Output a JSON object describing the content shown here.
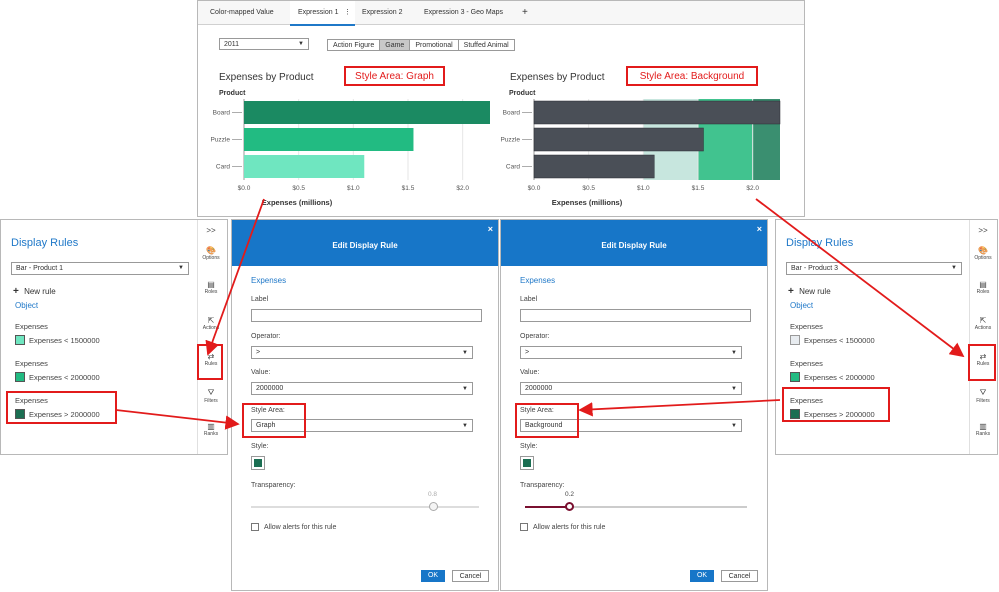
{
  "report": {
    "tabs": [
      "Color-mapped Value",
      "Expression 1",
      "Expression 2",
      "Expression 3 - Geo Maps"
    ],
    "add_tab": "+",
    "year_select": "2011",
    "category_buttons": [
      "Action Figure",
      "Game",
      "Promotional",
      "Stuffed Animal"
    ],
    "selected_category": "Game"
  },
  "annotations": {
    "graph": "Style Area:  Graph",
    "background": "Style Area:  Background"
  },
  "chart_data": [
    {
      "type": "bar",
      "title": "Expenses by Product",
      "ylabel": "Product",
      "xlabel": "Expenses (millions)",
      "categories": [
        "Board",
        "Puzzle",
        "Card"
      ],
      "values": [
        2.25,
        1.55,
        1.1
      ],
      "bar_colors": [
        "#1b8a62",
        "#22bb82",
        "#6fe6c0"
      ],
      "xticks": [
        "$0.0",
        "$0.5",
        "$1.0",
        "$1.5",
        "$2.0"
      ],
      "xlim": [
        0,
        2.25
      ]
    },
    {
      "type": "bar",
      "title": "Expenses by Product",
      "ylabel": "Product",
      "xlabel": "Expenses (millions)",
      "categories": [
        "Board",
        "Puzzle",
        "Card"
      ],
      "values": [
        2.25,
        1.55,
        1.1
      ],
      "bar_color": "#4a4f57",
      "bands": [
        {
          "from": 1.0,
          "to": 1.5,
          "color": "#c7e6de"
        },
        {
          "from": 1.5,
          "to": 2.0,
          "color": "#41c38f"
        },
        {
          "from": 2.0,
          "to": 2.25,
          "color": "#3a8f70"
        }
      ],
      "xticks": [
        "$0.0",
        "$0.5",
        "$1.0",
        "$1.5",
        "$2.0"
      ],
      "xlim": [
        0,
        2.25
      ]
    }
  ],
  "left_panel": {
    "title": "Display Rules",
    "object_select": "Bar - Product 1",
    "new_rule": "New rule",
    "object_link": "Object",
    "rules": [
      {
        "header": "Expenses",
        "label": "Expenses < 1500000",
        "color": "#6fe6c0"
      },
      {
        "header": "Expenses",
        "label": "Expenses < 2000000",
        "color": "#22bb82"
      },
      {
        "header": "Expenses",
        "label": "Expenses > 2000000",
        "color": "#1b6e52"
      }
    ]
  },
  "right_panel": {
    "title": "Display Rules",
    "object_select": "Bar - Product 3",
    "new_rule": "New rule",
    "object_link": "Object",
    "rules": [
      {
        "header": "Expenses",
        "label": "Expenses < 1500000",
        "color": "#e8ecf0"
      },
      {
        "header": "Expenses",
        "label": "Expenses < 2000000",
        "color": "#22bb82"
      },
      {
        "header": "Expenses",
        "label": "Expenses > 2000000",
        "color": "#1b6e52"
      }
    ]
  },
  "rail": {
    "collapse": ">>",
    "items": [
      "Options",
      "Roles",
      "Actions",
      "Rules",
      "Filters",
      "Ranks"
    ]
  },
  "dialog_left": {
    "title": "Edit Display Rule",
    "close": "×",
    "section": "Expenses",
    "label_caption": "Label",
    "operator_caption": "Operator:",
    "operator": ">",
    "value_caption": "Value:",
    "value": "2000000",
    "style_area_caption": "Style Area:",
    "style_area": "Graph",
    "style_caption": "Style:",
    "style_color": "#1b6e52",
    "transparency_caption": "Transparency:",
    "transparency": 0.8,
    "transparency_label": "0.8",
    "alerts": "Allow alerts for this rule",
    "ok": "OK",
    "cancel": "Cancel"
  },
  "dialog_right": {
    "title": "Edit Display Rule",
    "close": "×",
    "section": "Expenses",
    "label_caption": "Label",
    "operator_caption": "Operator:",
    "operator": ">",
    "value_caption": "Value:",
    "value": "2000000",
    "style_area_caption": "Style Area:",
    "style_area": "Background",
    "style_caption": "Style:",
    "style_color": "#1b6e52",
    "transparency_caption": "Transparency:",
    "transparency": 0.2,
    "transparency_label": "0.2",
    "alerts": "Allow alerts for this rule",
    "ok": "OK",
    "cancel": "Cancel"
  }
}
